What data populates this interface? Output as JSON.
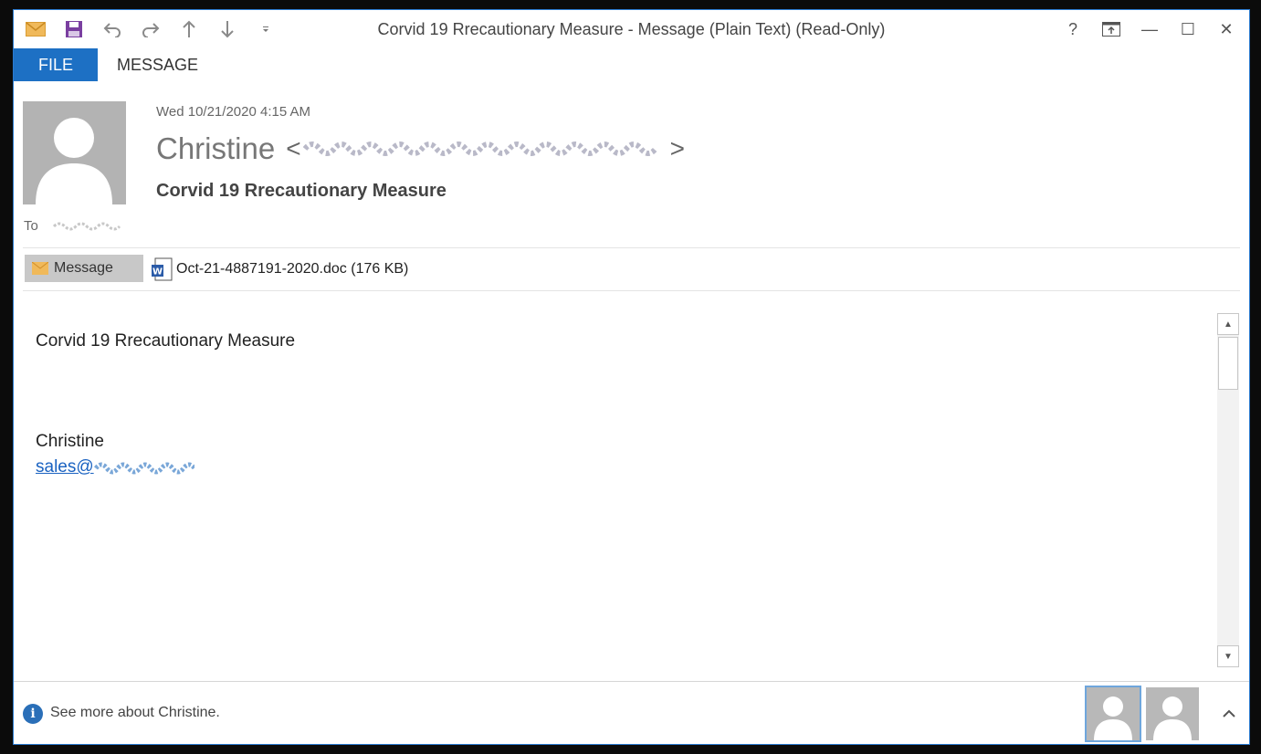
{
  "window": {
    "title": "Corvid 19 Rrecautionary Measure - Message (Plain Text) (Read-Only)",
    "help": "?",
    "minimize": "—",
    "maximize": "☐",
    "close": "✕"
  },
  "qat": {
    "icons": [
      "envelope-icon",
      "save-icon",
      "undo-icon",
      "redo-icon",
      "up-arrow-icon",
      "down-arrow-icon",
      "customize-icon"
    ]
  },
  "tabs": {
    "file": "FILE",
    "message": "MESSAGE"
  },
  "header": {
    "date": "Wed 10/21/2020 4:15 AM",
    "sender_name": "Christine",
    "lt": "<",
    "gt": ">",
    "subject": "Corvid 19 Rrecautionary Measure",
    "to_label": "To"
  },
  "attachments": {
    "message_label": "Message",
    "file_name": "Oct-21-4887191-2020.doc (176 KB)"
  },
  "body": {
    "line1": "Corvid 19 Rrecautionary Measure",
    "signature_name": "Christine",
    "email_prefix": "sales@"
  },
  "footer": {
    "see_more": "See more about Christine."
  },
  "colors": {
    "accent": "#1d70c4",
    "link": "#1a62c1",
    "info": "#2a6fb8"
  }
}
